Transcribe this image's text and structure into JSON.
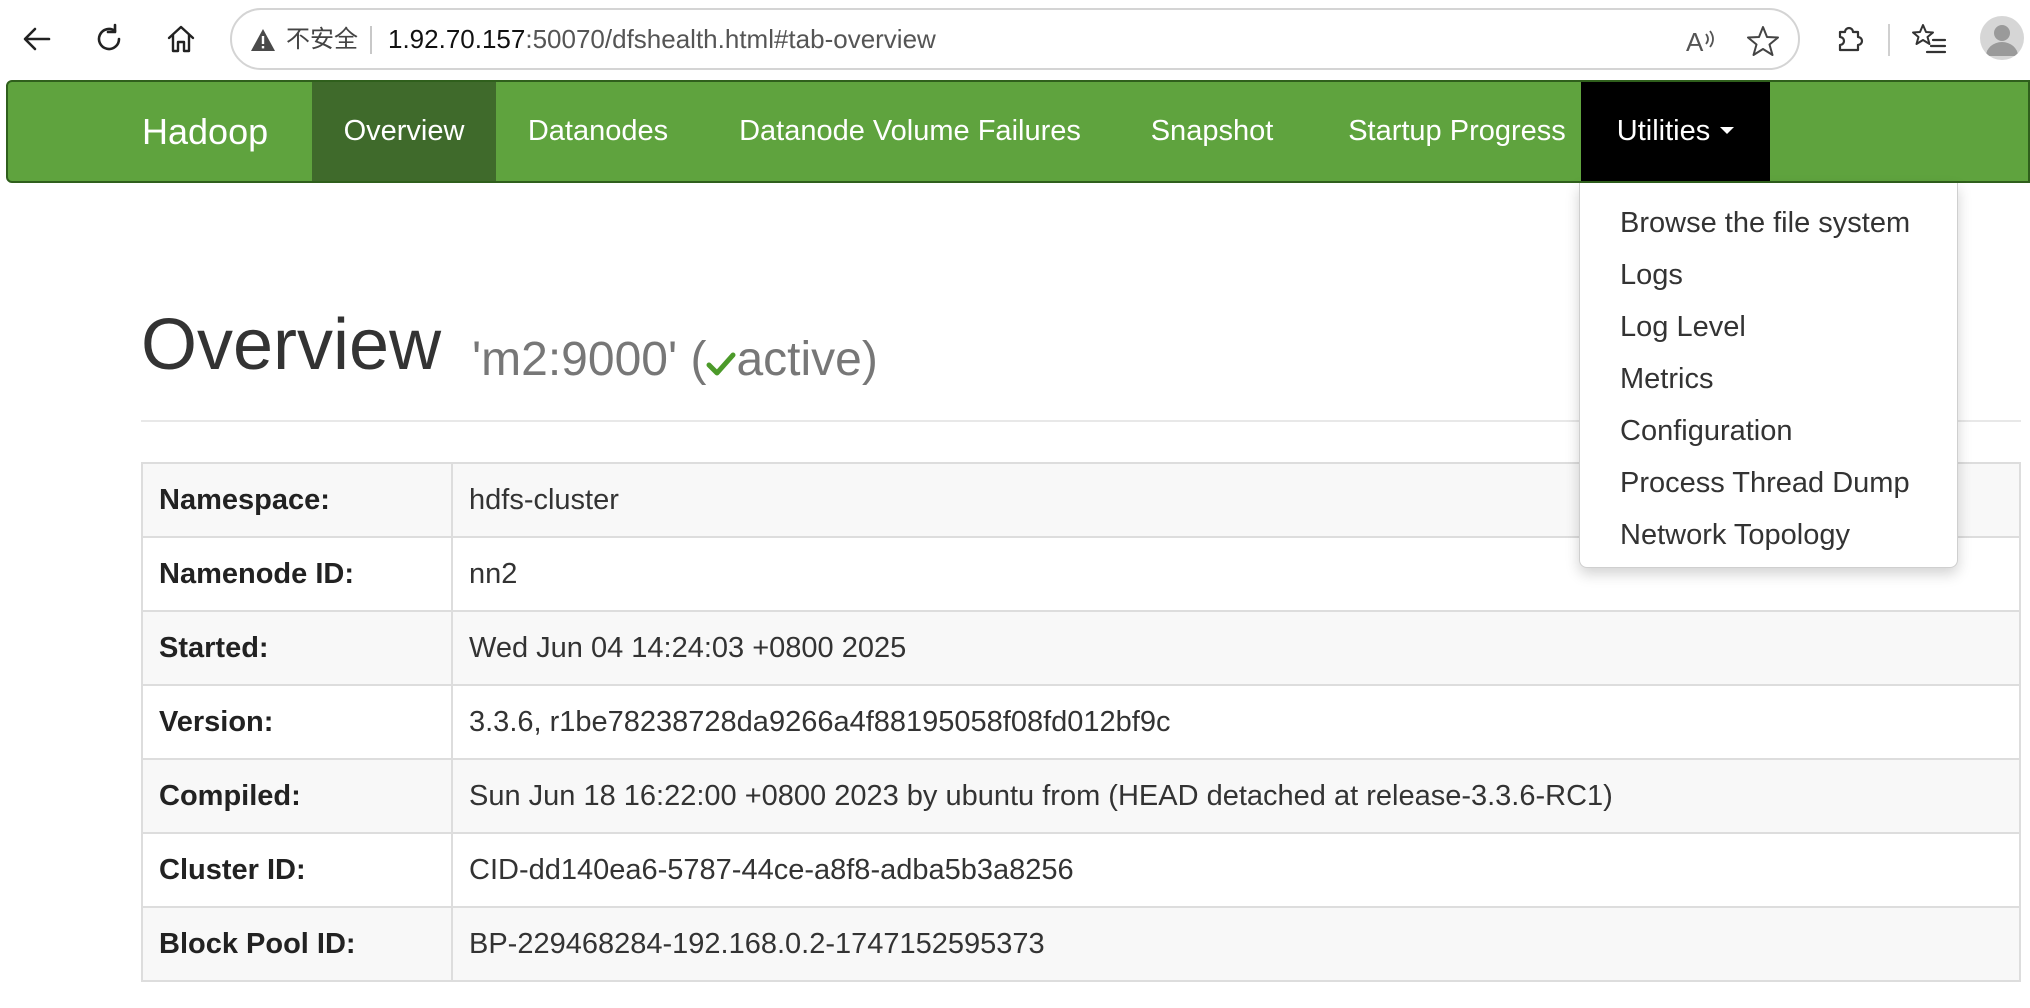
{
  "browser": {
    "security_label": "不安全",
    "url_host": "1.92.70.157",
    "url_rest": ":50070/dfshealth.html#tab-overview",
    "icons": [
      "back-icon",
      "reload-icon",
      "home-icon",
      "warning-icon",
      "read-aloud-icon",
      "favorite-star-icon",
      "extensions-icon",
      "favorites-list-icon",
      "profile-avatar"
    ]
  },
  "navbar": {
    "brand": "Hadoop",
    "items": [
      {
        "label": "Overview",
        "active": true
      },
      {
        "label": "Datanodes"
      },
      {
        "label": "Datanode Volume Failures"
      },
      {
        "label": "Snapshot"
      },
      {
        "label": "Startup Progress"
      },
      {
        "label": "Utilities",
        "open": true
      }
    ],
    "colors": {
      "bar": "#5fa33e",
      "active": "#3f6a2b",
      "open": "#000000"
    }
  },
  "utilities_menu": [
    "Browse the file system",
    "Logs",
    "Log Level",
    "Metrics",
    "Configuration",
    "Process Thread Dump",
    "Network Topology"
  ],
  "header": {
    "title": "Overview",
    "namenode": "'m2:9000'",
    "paren_open": "(",
    "state": "active",
    "paren_close": ")",
    "state_color": "#4c9a2a"
  },
  "info": [
    {
      "key": "Namespace:",
      "value": "hdfs-cluster"
    },
    {
      "key": "Namenode ID:",
      "value": "nn2"
    },
    {
      "key": "Started:",
      "value": "Wed Jun 04 14:24:03 +0800 2025"
    },
    {
      "key": "Version:",
      "value": "3.3.6, r1be78238728da9266a4f88195058f08fd012bf9c"
    },
    {
      "key": "Compiled:",
      "value": "Sun Jun 18 16:22:00 +0800 2023 by ubuntu from (HEAD detached at release-3.3.6-RC1)"
    },
    {
      "key": "Cluster ID:",
      "value": "CID-dd140ea6-5787-44ce-a8f8-adba5b3a8256"
    },
    {
      "key": "Block Pool ID:",
      "value": "BP-229468284-192.168.0.2-1747152595373"
    }
  ]
}
